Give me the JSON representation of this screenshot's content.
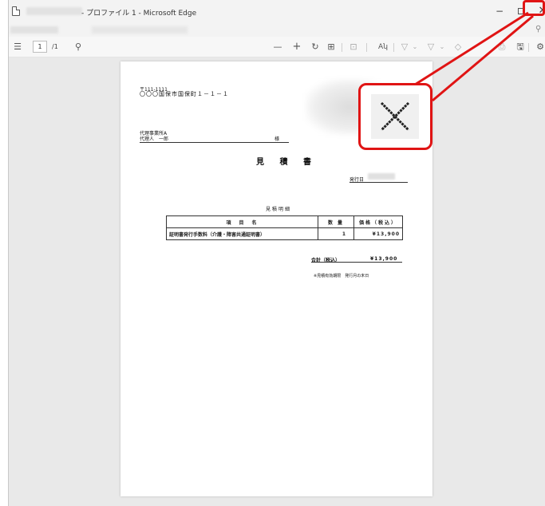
{
  "window": {
    "title": "- プロファイル 1 - Microsoft Edge",
    "controls": {
      "minimize": "−",
      "maximize": "",
      "close": "✕"
    }
  },
  "address_bar": {
    "zoom_icon": "magnifier-icon",
    "zoom_glyph": "⚲"
  },
  "pdf_toolbar": {
    "toc_glyph": "☰",
    "page_current": "1",
    "page_total": "/1",
    "search_glyph": "⚲",
    "zoom_out": "—",
    "zoom_in": "+",
    "rotate_glyph": "↻",
    "fit_glyph": "⊞",
    "view_glyph": "⊡",
    "read_aloud": "Aʮ",
    "draw_glyph": "▽",
    "dropdown_glyph": "⌄",
    "highlight_glyph": "▽",
    "erase_glyph": "◇",
    "print_glyph": "⎙",
    "save_glyph": "🖫",
    "settings_glyph": "⚙"
  },
  "document": {
    "postal_code": "〒111-1111",
    "address": "〇〇〇国保市国保町１－１－１",
    "office_name": "代理事業所A",
    "agent_name": "代理人　一郎",
    "honorific": "様",
    "title": "見 積 書",
    "issue_date_label": "発行日",
    "detail_title": "見積明細",
    "table": {
      "headers": [
        "項　目　名",
        "数 量",
        "価格（税込）"
      ],
      "rows": [
        [
          "証明書発行手数料（介護・障害共通証明書）",
          "1",
          "¥13,900"
        ]
      ]
    },
    "total_label": "合計（税込）",
    "total_value": "¥13,900",
    "validity_note": "※見積有効期限　発行月の末日"
  },
  "annotation": {
    "callout_color": "#e01414",
    "callout_icon": "close-icon"
  }
}
